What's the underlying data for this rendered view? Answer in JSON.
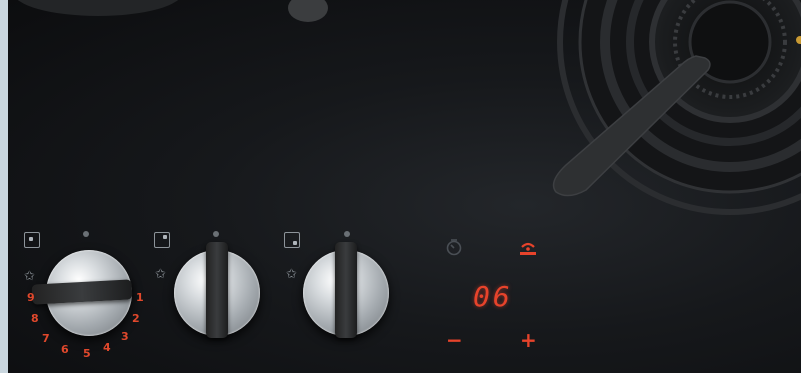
{
  "knob1": {
    "scale": [
      "1",
      "2",
      "3",
      "4",
      "5",
      "6",
      "7",
      "8",
      "9"
    ]
  },
  "touch_panel": {
    "timer_icon": "timer-icon",
    "power_icon": "power-level-icon",
    "display_value": "06",
    "minus_label": "−",
    "plus_label": "+"
  },
  "icons": {
    "spark": "✩"
  },
  "colors": {
    "glass": "#16181b",
    "led_red": "#e7432b",
    "steel": "#c8cdd1",
    "frame": "#c9d6de"
  }
}
